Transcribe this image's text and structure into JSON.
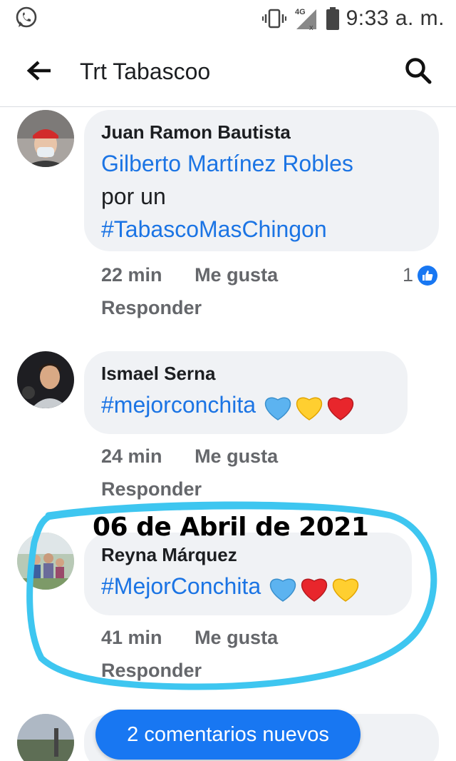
{
  "status_bar": {
    "time": "9:33 a. m.",
    "network": "4G"
  },
  "app_bar": {
    "title": "Trt Tabascoo"
  },
  "comments": [
    {
      "author": "Juan Ramon Bautista",
      "lines": [
        {
          "text": "Gilberto Martínez Robles",
          "link": true
        },
        {
          "text": "por un",
          "link": false
        },
        {
          "text": "#TabascoMasChingon",
          "link": true
        }
      ],
      "time": "22 min",
      "like_label": "Me gusta",
      "reply_label": "Responder",
      "reaction_count": "1"
    },
    {
      "author": "Ismael Serna",
      "hashtag": "#mejorconchita",
      "emojis": [
        "blue-heart",
        "yellow-heart",
        "red-heart"
      ],
      "time": "24 min",
      "like_label": "Me gusta",
      "reply_label": "Responder"
    },
    {
      "author": "Reyna Márquez",
      "hashtag": "#MejorConchita",
      "emojis": [
        "blue-heart",
        "red-heart",
        "yellow-heart"
      ],
      "time": "41 min",
      "like_label": "Me gusta",
      "reply_label": "Responder"
    }
  ],
  "annotation": {
    "date_text": "06 de Abril de 2021",
    "color": "#3ec6f0"
  },
  "new_comments_button": "2 comentarios nuevos",
  "colors": {
    "link": "#1b74e4",
    "bubble": "#f0f2f5",
    "meta": "#65676b",
    "primary": "#1877f2"
  }
}
